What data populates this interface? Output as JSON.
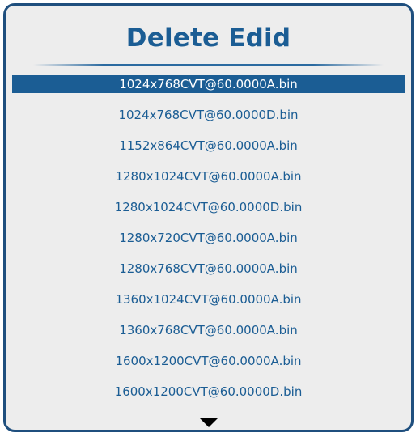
{
  "dialog": {
    "title": "Delete Edid"
  },
  "list": {
    "selected_index": 0,
    "items": [
      {
        "label": "1024x768CVT@60.0000A.bin"
      },
      {
        "label": "1024x768CVT@60.0000D.bin"
      },
      {
        "label": "1152x864CVT@60.0000A.bin"
      },
      {
        "label": "1280x1024CVT@60.0000A.bin"
      },
      {
        "label": "1280x1024CVT@60.0000D.bin"
      },
      {
        "label": "1280x720CVT@60.0000A.bin"
      },
      {
        "label": "1280x768CVT@60.0000A.bin"
      },
      {
        "label": "1360x1024CVT@60.0000A.bin"
      },
      {
        "label": "1360x768CVT@60.0000A.bin"
      },
      {
        "label": "1600x1200CVT@60.0000A.bin"
      },
      {
        "label": "1600x1200CVT@60.0000D.bin"
      }
    ]
  },
  "icons": {
    "scroll": "triangle-down-icon"
  },
  "colors": {
    "accent": "#1b5d94",
    "border": "#1f4f7e",
    "background": "#ededed",
    "selected_text": "#ffffff"
  }
}
